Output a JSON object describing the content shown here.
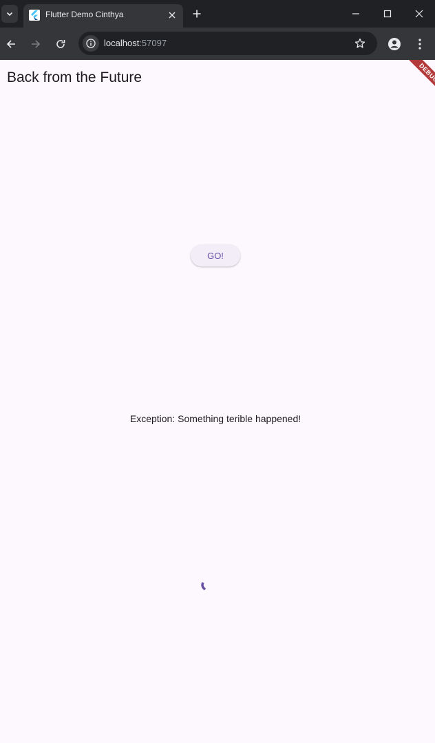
{
  "browser": {
    "tab_title": "Flutter Demo Cinthya",
    "url_host": "localhost",
    "url_port": ":57097",
    "icons": {
      "tab_search": "chevron-down-icon",
      "favicon": "flutter-logo-icon",
      "tab_close": "close-icon",
      "new_tab": "plus-icon",
      "minimize": "minimize-icon",
      "maximize": "maximize-icon",
      "close": "close-icon",
      "back": "arrow-left-icon",
      "forward": "arrow-right-icon",
      "reload": "reload-icon",
      "site_info": "info-icon",
      "bookmark": "star-icon",
      "profile": "person-icon",
      "menu": "kebab-menu-icon"
    }
  },
  "app": {
    "title": "Back from the Future",
    "debug_banner": "DEBUG",
    "go_button_label": "GO!",
    "message": "Exception: Something terible happened!",
    "colors": {
      "background": "#fdf7fe",
      "primary": "#6750a4",
      "button_bg": "#f3edf7",
      "debug": "#b23a3a"
    }
  }
}
